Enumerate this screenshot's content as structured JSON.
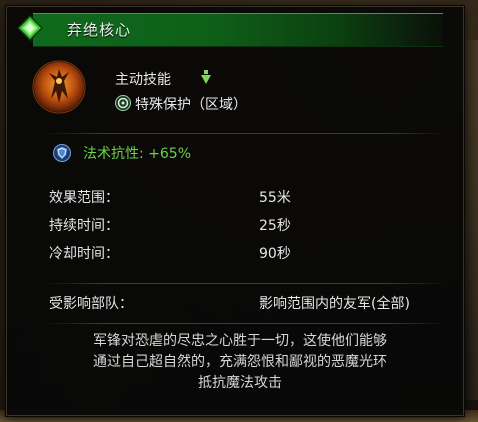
{
  "header": {
    "title": "弃绝核心",
    "icon": "green-diamond-icon",
    "accent_color": "#0f6b1c"
  },
  "skill": {
    "type_label": "主动技能",
    "subtype_label": "特殊保护（区域）",
    "icon": "skill-portrait-icon"
  },
  "resistance": {
    "text": "法术抗性: +65%",
    "color": "#6fd04a"
  },
  "stats": [
    {
      "label": "效果范围：",
      "value": "55米"
    },
    {
      "label": "持续时间：",
      "value": "25秒"
    },
    {
      "label": "冷却时间：",
      "value": "90秒"
    },
    {
      "label": "受影响部队：",
      "value": "影响范围内的友军(全部)"
    }
  ],
  "description": {
    "line1": "军锋对恐虐的尽忠之心胜于一切，这使他们能够",
    "line2": "通过自己超自然的，充满怨恨和鄙视的恶魔光环",
    "line3": "抵抗魔法攻击"
  }
}
